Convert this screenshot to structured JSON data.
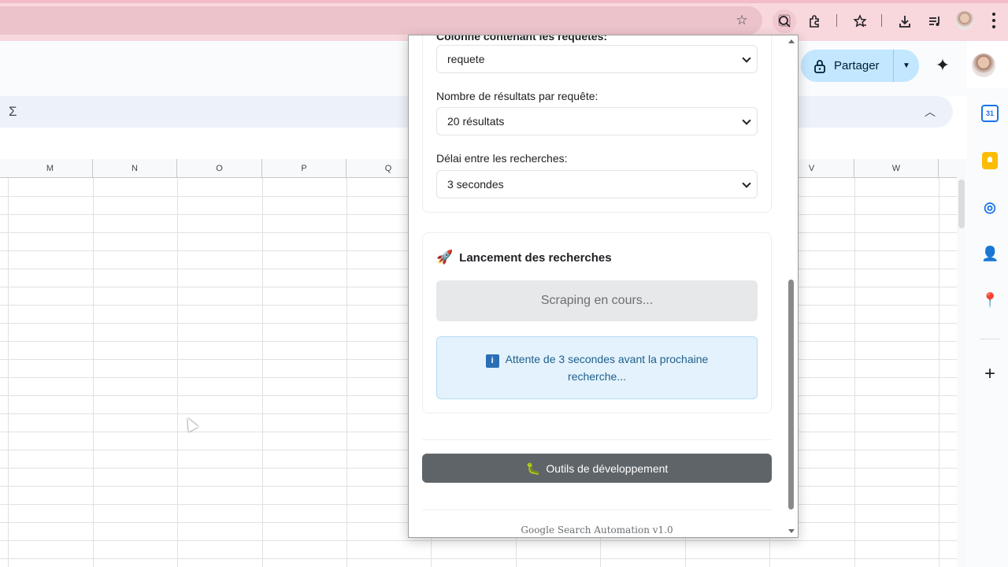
{
  "browser": {
    "toolbar_icons": [
      "star-icon",
      "lens-icon",
      "extensions-icon",
      "bookmarks-icon",
      "download-icon",
      "media-icon"
    ]
  },
  "sheets_header": {
    "share_label": "Partager"
  },
  "grid": {
    "columns": [
      "M",
      "N",
      "O",
      "P",
      "Q",
      "",
      "",
      "",
      "",
      "V",
      "W"
    ]
  },
  "sidebar": {
    "icons": [
      "calendar-icon",
      "keep-icon",
      "tasks-icon",
      "contacts-icon",
      "maps-icon",
      "add-icon"
    ],
    "calendar_label": "31"
  },
  "popup": {
    "cut_label": "Colonne contenant les requêtes:",
    "query_column": {
      "value": "requete"
    },
    "results": {
      "label": "Nombre de résultats par requête:",
      "value": "20 résultats"
    },
    "delay": {
      "label": "Délai entre les recherches:",
      "value": "3 secondes"
    },
    "launch": {
      "title": "Lancement des recherches",
      "button": "Scraping en cours...",
      "info": "Attente de 3 secondes avant la prochaine recherche..."
    },
    "dev_tools": "Outils de développement",
    "footer": "Google Search Automation v1.0"
  },
  "colors": {
    "browser_bar": "#f8d7dd",
    "share_button": "#c2e7ff",
    "info_box": "#e3f2fc",
    "dev_button": "#5f6468"
  }
}
